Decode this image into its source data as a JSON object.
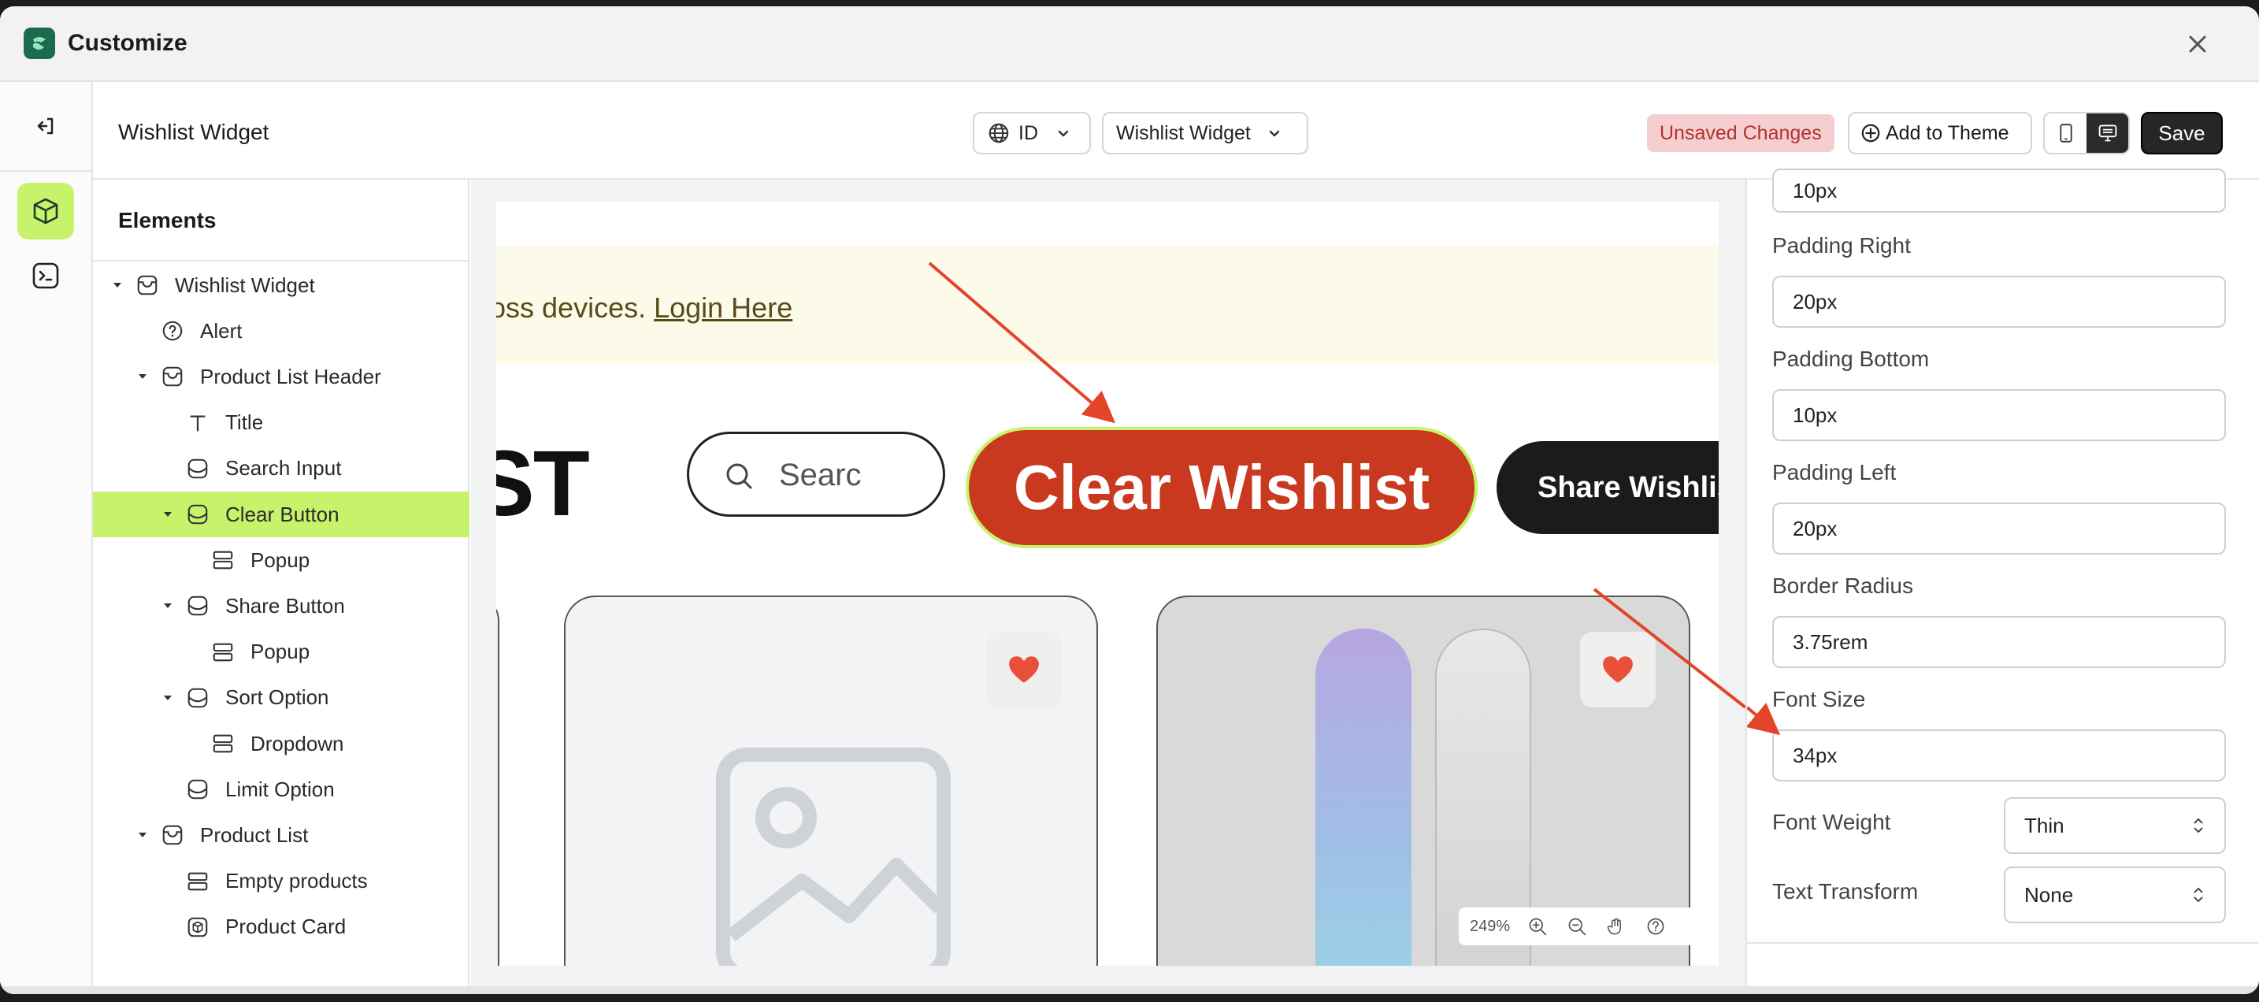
{
  "window": {
    "title": "Customize"
  },
  "toolbar": {
    "doc_title": "Wishlist Widget",
    "language": "ID",
    "template": "Wishlist Widget",
    "unsaved": "Unsaved Changes",
    "add_to_theme": "Add to Theme",
    "save": "Save"
  },
  "elements": {
    "heading": "Elements",
    "items": [
      {
        "label": "Wishlist Widget",
        "icon": "widget-icon",
        "level": 0,
        "expanded": true
      },
      {
        "label": "Alert",
        "icon": "question-circle-icon",
        "level": 1
      },
      {
        "label": "Product List Header",
        "icon": "widget-icon",
        "level": 1,
        "expanded": true
      },
      {
        "label": "Title",
        "icon": "text-icon",
        "level": 2
      },
      {
        "label": "Search Input",
        "icon": "block-icon",
        "level": 2
      },
      {
        "label": "Clear Button",
        "icon": "block-icon",
        "level": 2,
        "expanded": true,
        "selected": true
      },
      {
        "label": "Popup",
        "icon": "rows-icon",
        "level": 3
      },
      {
        "label": "Share Button",
        "icon": "block-icon",
        "level": 2,
        "expanded": true
      },
      {
        "label": "Popup",
        "icon": "rows-icon",
        "level": 3
      },
      {
        "label": "Sort Option",
        "icon": "block-icon",
        "level": 2,
        "expanded": true
      },
      {
        "label": "Dropdown",
        "icon": "rows-icon",
        "level": 3
      },
      {
        "label": "Limit Option",
        "icon": "block-icon",
        "level": 2
      },
      {
        "label": "Product List",
        "icon": "widget-icon",
        "level": 1,
        "expanded": true
      },
      {
        "label": "Empty products",
        "icon": "rows-icon",
        "level": 2
      },
      {
        "label": "Product Card",
        "icon": "product-card-icon",
        "level": 2
      }
    ]
  },
  "preview": {
    "alert_text": "oss devices. ",
    "alert_link": "Login Here",
    "list_title": "ST",
    "search_placeholder": "Searc",
    "clear_button": "Clear Wishlist",
    "share_button": "Share Wishlist",
    "zoom": "249%"
  },
  "properties": {
    "padding_top_value": "10px",
    "padding_right_label": "Padding Right",
    "padding_right_value": "20px",
    "padding_bottom_label": "Padding Bottom",
    "padding_bottom_value": "10px",
    "padding_left_label": "Padding Left",
    "padding_left_value": "20px",
    "border_radius_label": "Border Radius",
    "border_radius_value": "3.75rem",
    "font_size_label": "Font Size",
    "font_size_value": "34px",
    "font_weight_label": "Font Weight",
    "font_weight_value": "Thin",
    "text_transform_label": "Text Transform",
    "text_transform_value": "None"
  },
  "colors": {
    "accent": "#c6f36a",
    "clear_button": "#c8391f",
    "arrow": "#e2452a"
  }
}
